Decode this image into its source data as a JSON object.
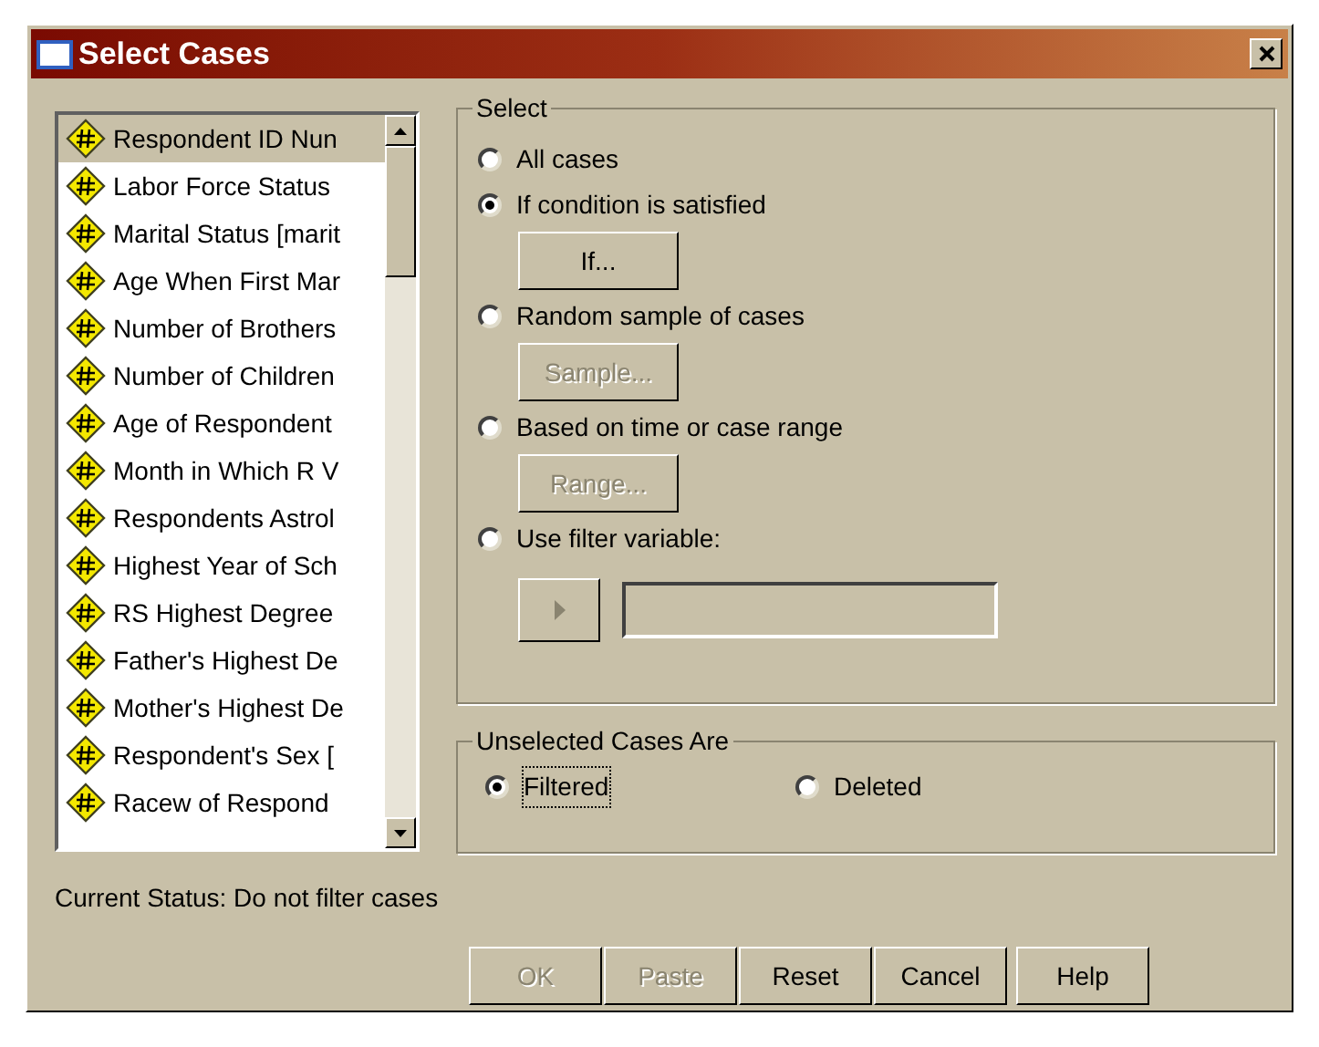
{
  "window": {
    "title": "Select Cases"
  },
  "variables": [
    {
      "label": "Respondent ID Nun",
      "selected": true
    },
    {
      "label": "Labor Force Status",
      "selected": false
    },
    {
      "label": "Marital Status [marit",
      "selected": false
    },
    {
      "label": "Age When First Mar",
      "selected": false
    },
    {
      "label": "Number of Brothers",
      "selected": false
    },
    {
      "label": "Number of Children",
      "selected": false
    },
    {
      "label": "Age of Respondent",
      "selected": false
    },
    {
      "label": "Month in Which R V",
      "selected": false
    },
    {
      "label": "Respondents Astrol",
      "selected": false
    },
    {
      "label": "Highest Year of Sch",
      "selected": false
    },
    {
      "label": "RS Highest Degree",
      "selected": false
    },
    {
      "label": "Father's Highest De",
      "selected": false
    },
    {
      "label": "Mother's Highest De",
      "selected": false
    },
    {
      "label": "Respondent's Sex [",
      "selected": false
    },
    {
      "label": "Racew of Respond",
      "selected": false
    }
  ],
  "select_group": {
    "title": "Select",
    "options": [
      {
        "label": "All cases",
        "selected": false
      },
      {
        "label": "If condition is satisfied",
        "selected": true,
        "button": {
          "label": "If...",
          "disabled": false
        }
      },
      {
        "label": "Random sample of cases",
        "selected": false,
        "button": {
          "label": "Sample...",
          "disabled": true
        }
      },
      {
        "label": "Based on time or case range",
        "selected": false,
        "button": {
          "label": "Range...",
          "disabled": true
        }
      },
      {
        "label": "Use filter variable:",
        "selected": false
      }
    ]
  },
  "unselected_group": {
    "title": "Unselected Cases Are",
    "options": [
      {
        "label": "Filtered",
        "selected": true
      },
      {
        "label": "Deleted",
        "selected": false
      }
    ]
  },
  "status": "Current Status: Do not filter cases",
  "buttons": [
    {
      "label": "OK",
      "disabled": true
    },
    {
      "label": "Paste",
      "disabled": true
    },
    {
      "label": "Reset",
      "disabled": false
    },
    {
      "label": "Cancel",
      "disabled": false
    },
    {
      "label": "Help",
      "disabled": false
    }
  ]
}
